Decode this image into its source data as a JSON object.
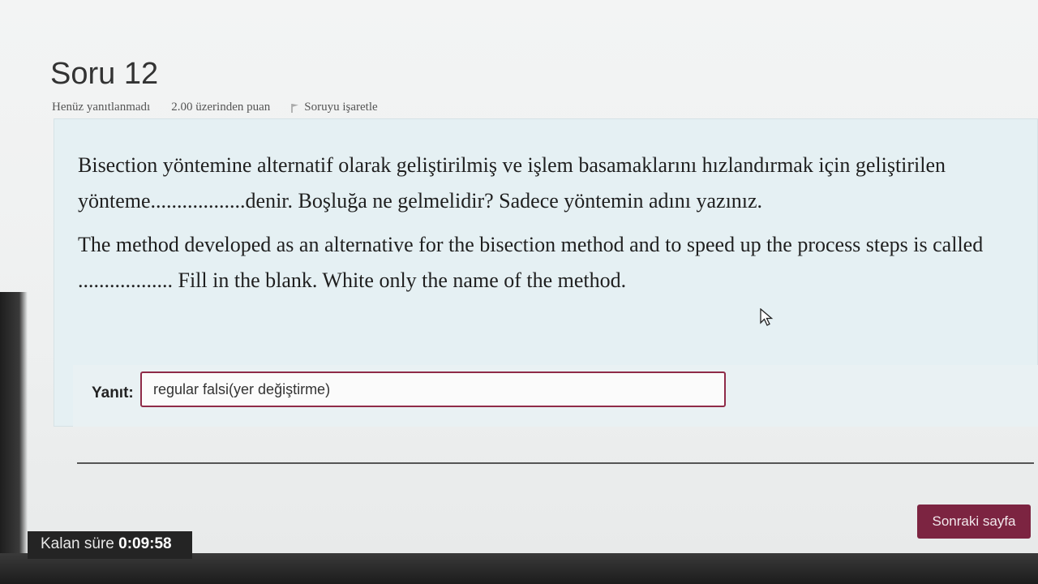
{
  "question": {
    "title": "Soru 12",
    "status": "Henüz yanıtlanmadı",
    "points": "2.00 üzerinden puan",
    "flag_label": "Soruyu işaretle",
    "text_tr": "Bisection yöntemine alternatif olarak geliştirilmiş ve işlem basamaklarını hızlandırmak için geliştirilen yönteme..................denir. Boşluğa ne gelmelidir? Sadece yöntemin adını yazınız.",
    "text_en": "The method developed as an alternative for the bisection method and to speed up the process steps is called .................. Fill in the blank. White only the name of the method."
  },
  "answer": {
    "label": "Yanıt:",
    "value": "regular falsi(yer değiştirme)"
  },
  "nav": {
    "next_label": "Sonraki sayfa"
  },
  "timer": {
    "label": "Kalan süre",
    "value": "0:09:58"
  },
  "colors": {
    "accent": "#7c2441",
    "input_border": "#8f2b48",
    "question_bg": "#e5f0f3"
  }
}
